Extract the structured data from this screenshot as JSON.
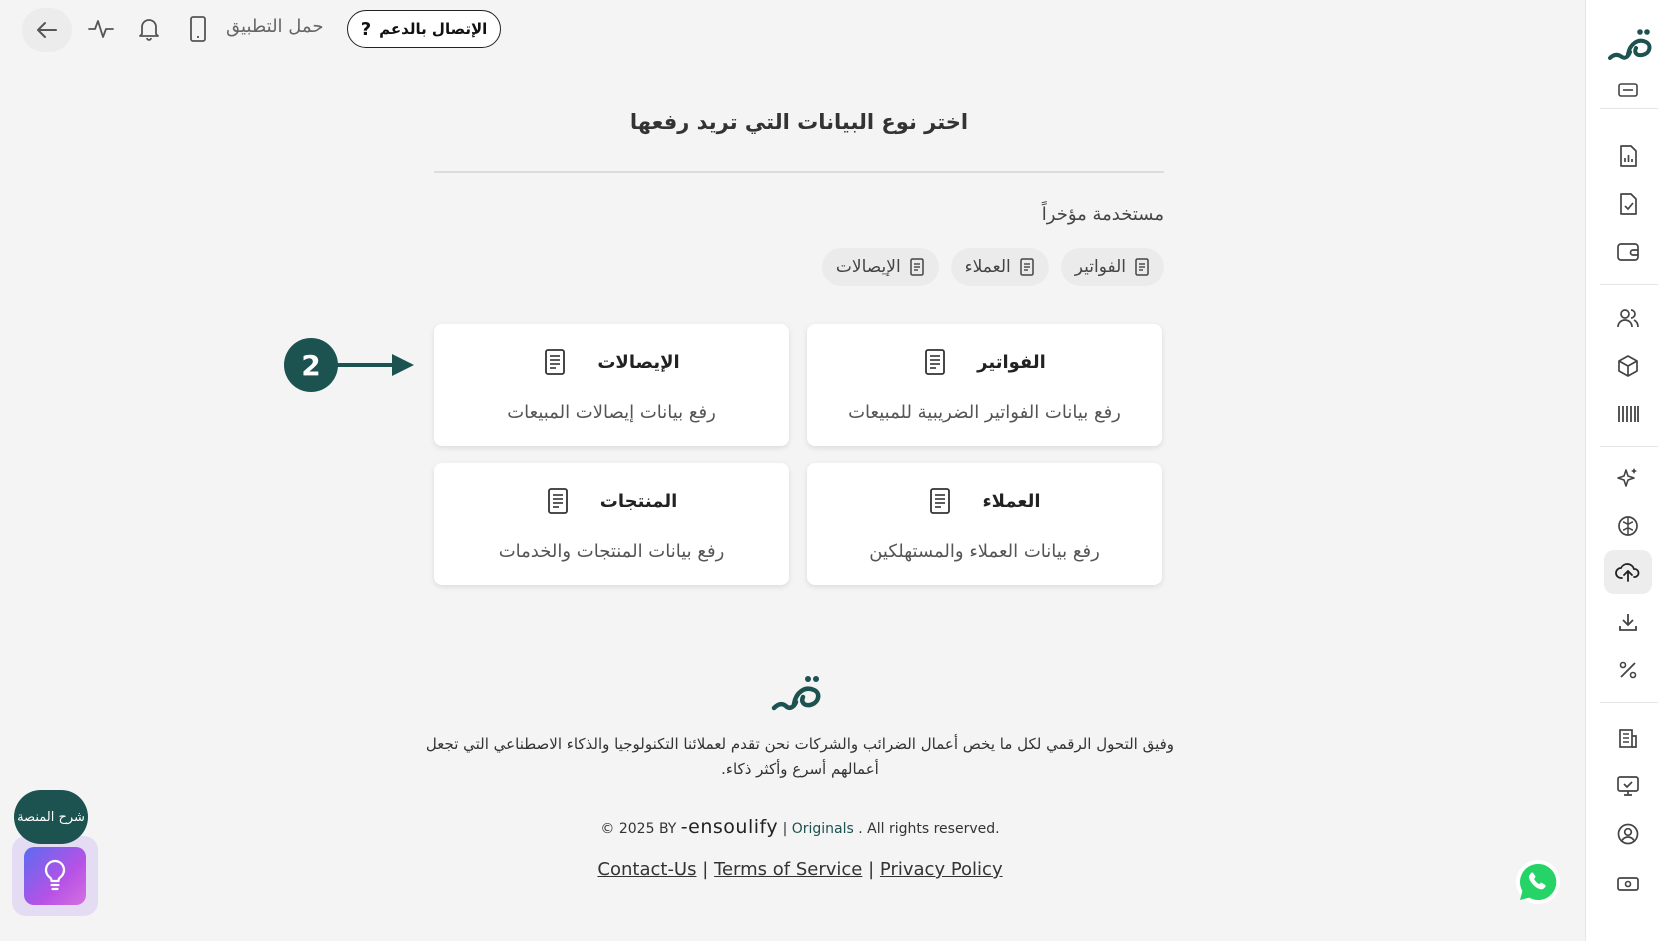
{
  "topbar": {
    "download_app": "حمل التطبيق",
    "support_label": "الإتصال بالدعم",
    "support_icon": "?"
  },
  "main": {
    "title": "اختر نوع البيانات التي تريد رفعها",
    "recent_label": "مستخدمة مؤخراً",
    "recent_chips": [
      "الفواتير",
      "العملاء",
      "الإيصالات"
    ],
    "cards": [
      {
        "title": "الفواتير",
        "desc": "رفع بيانات الفواتير الضريبية للمبيعات",
        "icon": "document-icon"
      },
      {
        "title": "الإيصالات",
        "desc": "رفع بيانات إيصالات المبيعات",
        "icon": "document-icon"
      },
      {
        "title": "العملاء",
        "desc": "رفع بيانات العملاء والمستهلكين",
        "icon": "document-icon"
      },
      {
        "title": "المنتجات",
        "desc": "رفع بيانات المنتجات والخدمات",
        "icon": "document-icon"
      }
    ],
    "step_number": "2"
  },
  "footer": {
    "description": "وفيق التحول الرقمي لكل ما يخص أعمال الضرائب والشركات نحن تقدم لعملائنا التكنولوجيا والذكاء الاصطناعي التي تجعل أعمالهم أسرع وأكثر ذكاء.",
    "copyright_prefix": "© 2025 BY",
    "brand": "-ensoulify",
    "separator": "|",
    "originals": "Originals",
    "rights": ". All rights reserved.",
    "links": [
      "Contact-Us",
      "Terms of Service",
      "Privacy Policy"
    ]
  },
  "floating": {
    "help_label": "شرح المنصة"
  },
  "colors": {
    "brand_green": "#1c524f",
    "background": "#f4f4f4",
    "whatsapp_green": "#25d366"
  },
  "sidebar_icons": [
    "logo",
    "list-icon",
    "report-icon",
    "file-check-icon",
    "wallet-icon",
    "users-icon",
    "box-icon",
    "barcode-icon",
    "sparkles-icon",
    "brain-icon",
    "cloud-upload-icon",
    "download-icon",
    "percent-icon",
    "building-icon",
    "monitor-icon",
    "user-circle-icon",
    "money-icon"
  ]
}
